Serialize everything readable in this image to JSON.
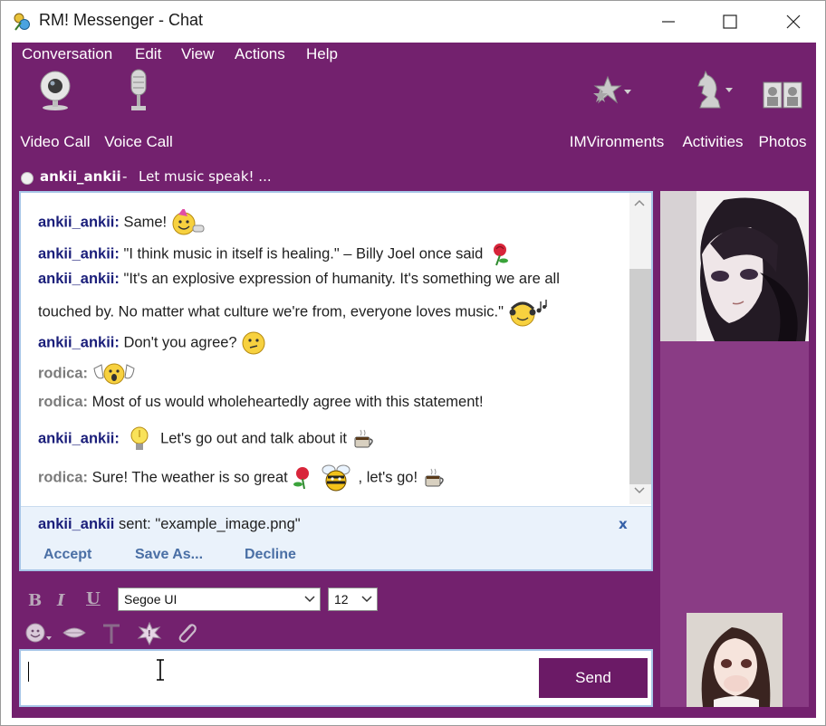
{
  "window": {
    "title": "RM! Messenger - Chat"
  },
  "menu": [
    "Conversation",
    "Edit",
    "View",
    "Actions",
    "Help"
  ],
  "toolbar": {
    "video_call": "Video Call",
    "voice_call": "Voice Call",
    "imvironments": "IMVironments",
    "activities": "Activities",
    "photos": "Photos"
  },
  "contact": {
    "name": "ankii_ankii",
    "separator": "-",
    "status_message": "Let music speak! ..."
  },
  "messages": [
    {
      "nick": "ankii_ankii:",
      "text": " Same!"
    },
    {
      "nick": "ankii_ankii:",
      "text": " \"I think music in itself is healing.\" – Billy Joel once said"
    },
    {
      "nick": "ankii_ankii:",
      "text": " \"It's an explosive expression of humanity. It's something we are all"
    },
    {
      "nick": "",
      "text": "touched by. No matter what culture we're from, everyone loves music.\""
    },
    {
      "nick": "ankii_ankii:",
      "text": " Don't you agree?"
    },
    {
      "nick": "rodica:",
      "text": ""
    },
    {
      "nick": "rodica:",
      "text": " Most of us would wholeheartedly agree with this statement!"
    },
    {
      "nick": "ankii_ankii:",
      "text": "  Let's go out and talk about it"
    },
    {
      "nick": "rodica:",
      "text": " Sure! The weather is so great"
    },
    {
      "nick": "",
      "text": " , let's go!"
    }
  ],
  "file_transfer": {
    "sender": "ankii_ankii",
    "text": " sent: \"example_image.png\"",
    "close": "x",
    "accept": "Accept",
    "save_as": "Save As...",
    "decline": "Decline"
  },
  "format": {
    "bold": "B",
    "italic": "I",
    "underline": "U",
    "font": "Segoe UI",
    "size": "12"
  },
  "input": {
    "send": "Send"
  },
  "colors": {
    "accent": "#73216e",
    "nick_self": "#1a1e7a",
    "nick_other": "#7b7b7b"
  }
}
